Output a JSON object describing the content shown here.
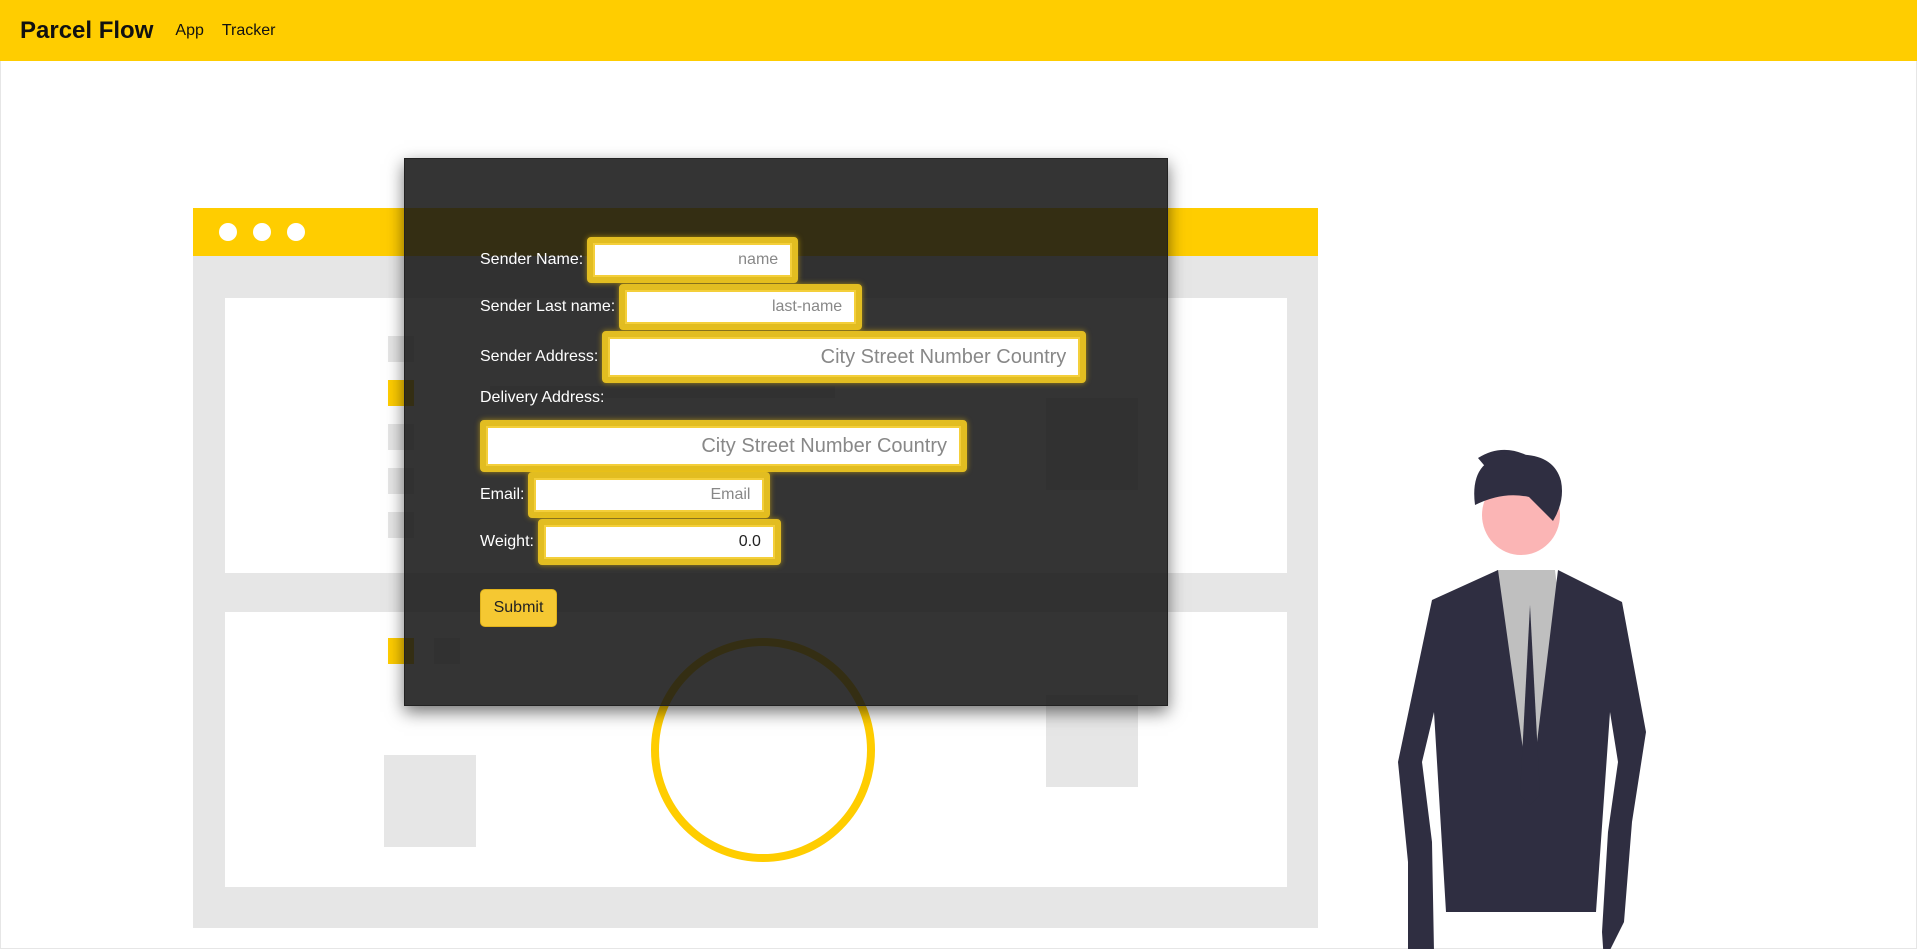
{
  "navbar": {
    "brand": "Parcel Flow",
    "links": [
      "App",
      "Tracker"
    ]
  },
  "form": {
    "sender_name": {
      "label": "Sender Name:",
      "placeholder": "name"
    },
    "sender_last_name": {
      "label": "Sender Last name:",
      "placeholder": "last-name"
    },
    "sender_address": {
      "label": "Sender Address:",
      "placeholder": "City Street Number Country"
    },
    "delivery_address": {
      "label": "Delivery Address:",
      "placeholder": "City Street Number Country"
    },
    "email": {
      "label": "Email:",
      "placeholder": "Email"
    },
    "weight": {
      "label": "Weight:",
      "value": "0.0"
    },
    "submit_label": "Submit"
  },
  "colors": {
    "accent": "#ffcd00",
    "modal_bg": "#161616",
    "figure_suit": "#2f2e41",
    "illustration_gray": "#e6e6e6"
  }
}
